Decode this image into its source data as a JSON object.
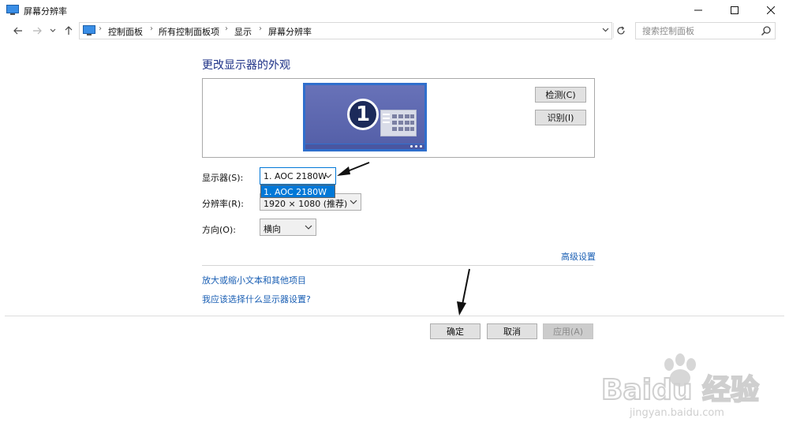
{
  "window": {
    "title": "屏幕分辨率"
  },
  "breadcrumbs": [
    "控制面板",
    "所有控制面板项",
    "显示",
    "屏幕分辨率"
  ],
  "search": {
    "placeholder": "搜索控制面板"
  },
  "main": {
    "heading": "更改显示器的外观",
    "monitor_number": "1",
    "detect_button": "检测(C)",
    "identify_button": "识别(I)",
    "display_label": "显示器(S):",
    "display_value": "1. AOC 2180W",
    "display_dropdown_option": "1. AOC 2180W",
    "resolution_label": "分辨率(R):",
    "resolution_value": "1920 × 1080 (推荐)",
    "orientation_label": "方向(O):",
    "orientation_value": "横向",
    "advanced_link": "高级设置",
    "link_text_size": "放大或缩小文本和其他项目",
    "link_which_settings": "我应该选择什么显示器设置?"
  },
  "footer": {
    "ok": "确定",
    "cancel": "取消",
    "apply": "应用(A)"
  },
  "watermark": {
    "text": "jingyan.baidu.com",
    "brand": "Baidu 经验"
  },
  "colors": {
    "accent": "#0078d7",
    "heading": "#1e3287",
    "link": "#1a5fb4",
    "monitor": "#2f6fcd"
  }
}
